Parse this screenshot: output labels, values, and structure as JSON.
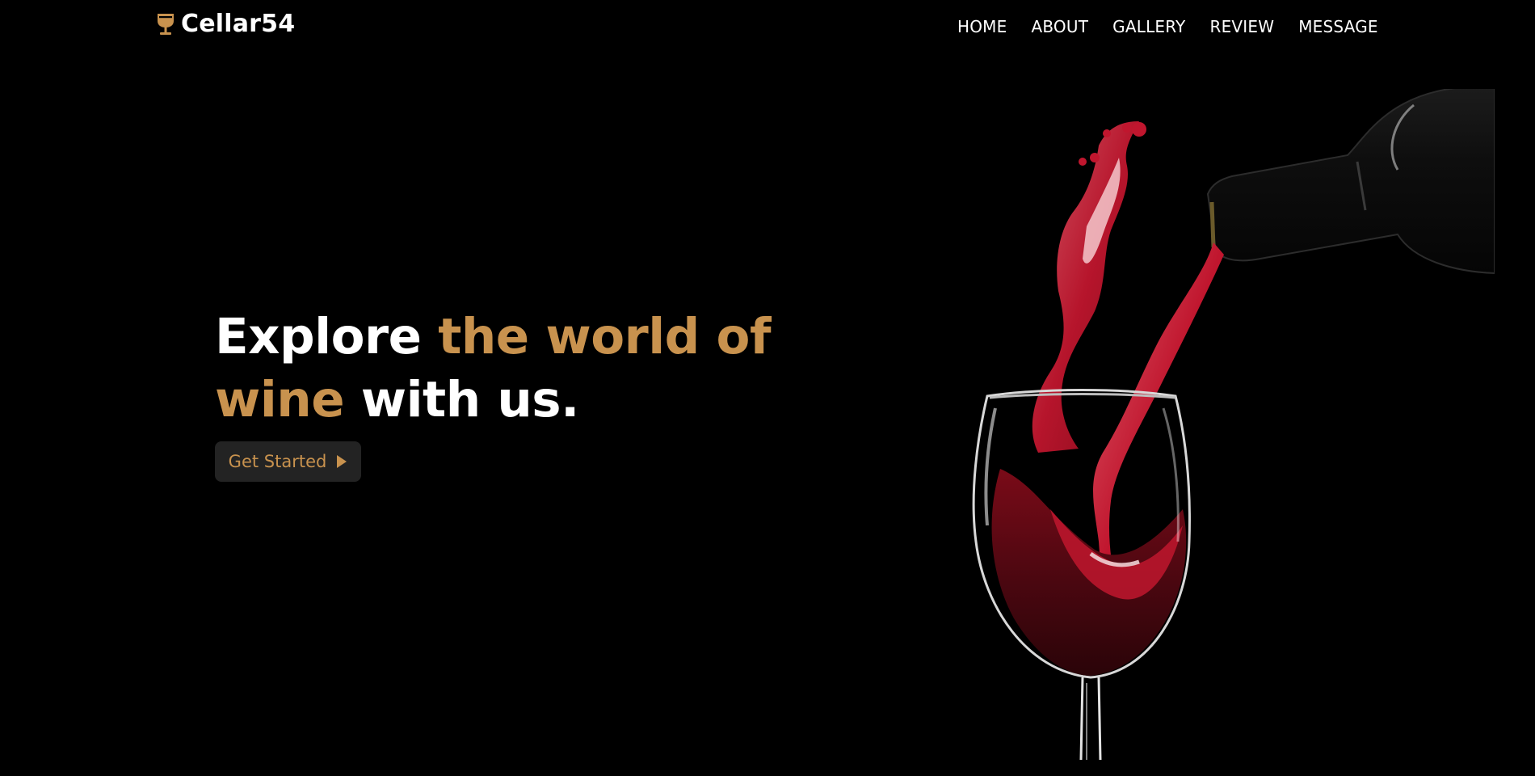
{
  "brand": {
    "name": "Cellar54",
    "icon": "wine-glass-icon"
  },
  "nav": {
    "items": [
      {
        "label": "HOME"
      },
      {
        "label": "ABOUT"
      },
      {
        "label": "GALLERY"
      },
      {
        "label": "REVIEW"
      },
      {
        "label": "MESSAGE"
      }
    ]
  },
  "hero": {
    "title_part1": "Explore ",
    "title_accent1": "the world of",
    "title_accent2": "wine",
    "title_part2": " with us.",
    "cta_label": "Get Started",
    "cta_icon": "play-icon",
    "image": "wine-pour-image"
  },
  "colors": {
    "background": "#000000",
    "accent": "#c8924e",
    "text": "#ffffff",
    "button_bg": "#232323",
    "wine": "#b3132a"
  }
}
